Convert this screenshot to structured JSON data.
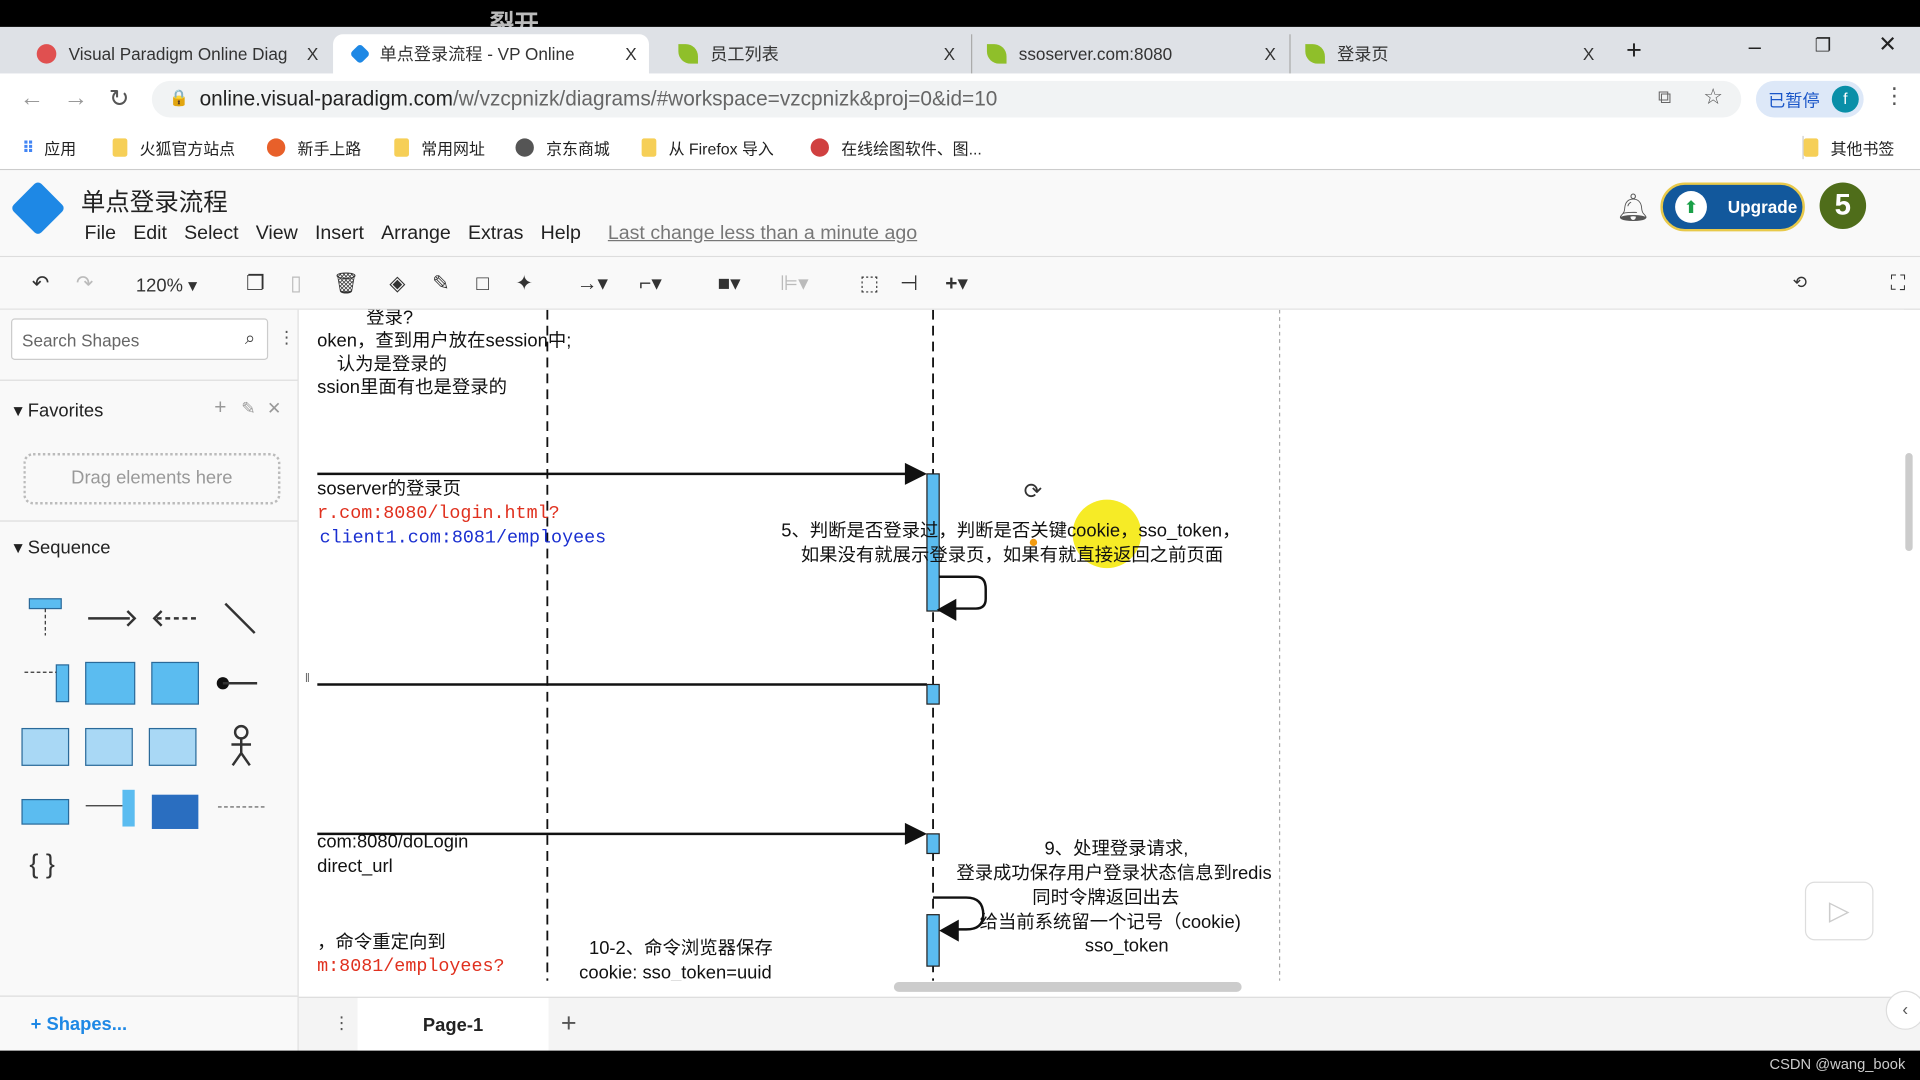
{
  "watermark": "裂开",
  "browser": {
    "tabs": [
      {
        "label": "Visual Paradigm Online Diag",
        "active": false
      },
      {
        "label": "单点登录流程 - VP Online",
        "active": true
      },
      {
        "label": "员工列表",
        "active": false
      },
      {
        "label": "ssoserver.com:8080",
        "active": false
      },
      {
        "label": "登录页",
        "active": false
      }
    ],
    "close_glyph": "X",
    "new_tab": "+",
    "url_host": "online.visual-paradigm.com",
    "url_path": "/w/vzcpnizk/diagrams/#workspace=vzcpnizk&proj=0&id=10",
    "profile_label": "已暂停",
    "profile_initial": "f",
    "bookmarks": [
      "应用",
      "火狐官方站点",
      "新手上路",
      "常用网址",
      "京东商城",
      "从 Firefox 导入",
      "在线绘图软件、图..."
    ],
    "other_bookmarks": "其他书签"
  },
  "app": {
    "title": "单点登录流程",
    "menu": [
      "File",
      "Edit",
      "Select",
      "View",
      "Insert",
      "Arrange",
      "Extras",
      "Help"
    ],
    "last_change": "Last change less than a minute ago",
    "upgrade_label": "Upgrade",
    "user_badge": "5",
    "zoom": "120%"
  },
  "sidebar": {
    "search_placeholder": "Search Shapes",
    "favorites_label": "Favorites",
    "drag_hint": "Drag elements here",
    "sequence_label": "Sequence",
    "shapes_link": "+ Shapes..."
  },
  "canvas": {
    "texts": [
      "登录?",
      "oken，查到用户放在session中;",
      "认为是登录的",
      "ssion里面有也是登录的",
      "soserver的登录页",
      "r.com:8080/login.html?",
      "client1.com:8081/employees",
      "5、判断是否登录过，判断是否关键cookie，sso_token，",
      "如果没有就展示登录页，如果有就直接返回之前页面",
      "com:8080/doLogin",
      "direct_url",
      "9、处理登录请求,",
      "登录成功保存用户登录状态信息到redis",
      "同时令牌返回出去",
      "给当前系统留一个记号（cookie)",
      "sso_token",
      "，命令重定向到",
      "m:8081/employees?",
      "10-2、命令浏览器保存",
      "cookie: sso_token=uuid"
    ],
    "colors": {
      "activation": "#5bbcf0",
      "red_link": "#e0301e",
      "blue_link": "#1a2fd0",
      "highlight": "#f5e800"
    }
  },
  "pages": {
    "current": "Page-1"
  },
  "footer": {
    "credit": "CSDN @wang_book"
  }
}
